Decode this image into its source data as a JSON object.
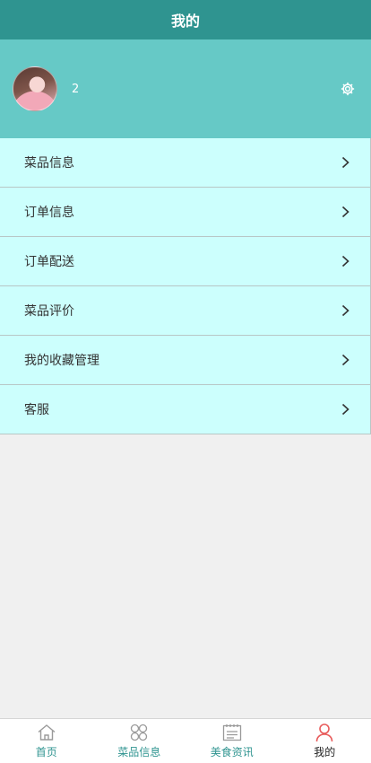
{
  "header": {
    "title": "我的"
  },
  "profile": {
    "username": "2"
  },
  "menu": {
    "items": [
      {
        "label": "菜品信息"
      },
      {
        "label": "订单信息"
      },
      {
        "label": "订单配送"
      },
      {
        "label": "菜品评价"
      },
      {
        "label": "我的收藏管理"
      },
      {
        "label": "客服"
      }
    ]
  },
  "tabbar": {
    "tabs": [
      {
        "label": "首页",
        "icon": "home-icon"
      },
      {
        "label": "菜品信息",
        "icon": "grid-icon"
      },
      {
        "label": "美食资讯",
        "icon": "news-icon"
      },
      {
        "label": "我的",
        "icon": "user-icon",
        "active": true
      }
    ]
  },
  "colors": {
    "header_bg": "#2f9490",
    "profile_bg": "#66c9c6",
    "menu_bg": "#ccfffd",
    "tab_active_icon": "#e85b5b"
  }
}
